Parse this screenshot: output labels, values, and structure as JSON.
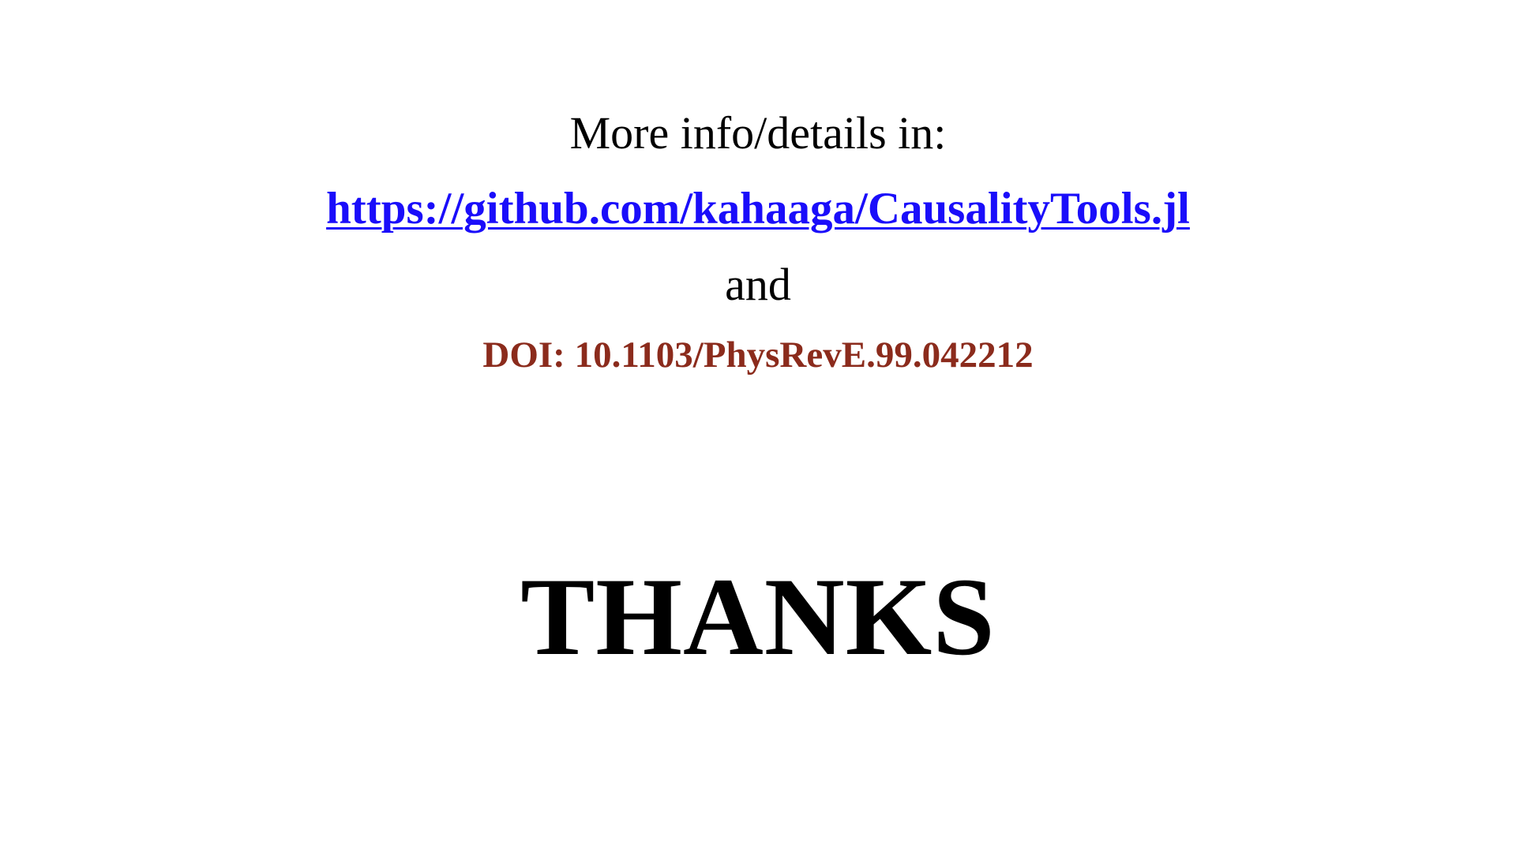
{
  "slide": {
    "intro_text": "More info/details in:",
    "link_text": "https://github.com/kahaaga/CausalityTools.jl",
    "connector_text": "and",
    "doi_text": "DOI: 10.1103/PhysRevE.99.042212",
    "closing_text": "THANKS"
  },
  "colors": {
    "link": "#1a0dfa",
    "doi": "#8b2b1c",
    "text": "#000000",
    "background": "#ffffff"
  }
}
